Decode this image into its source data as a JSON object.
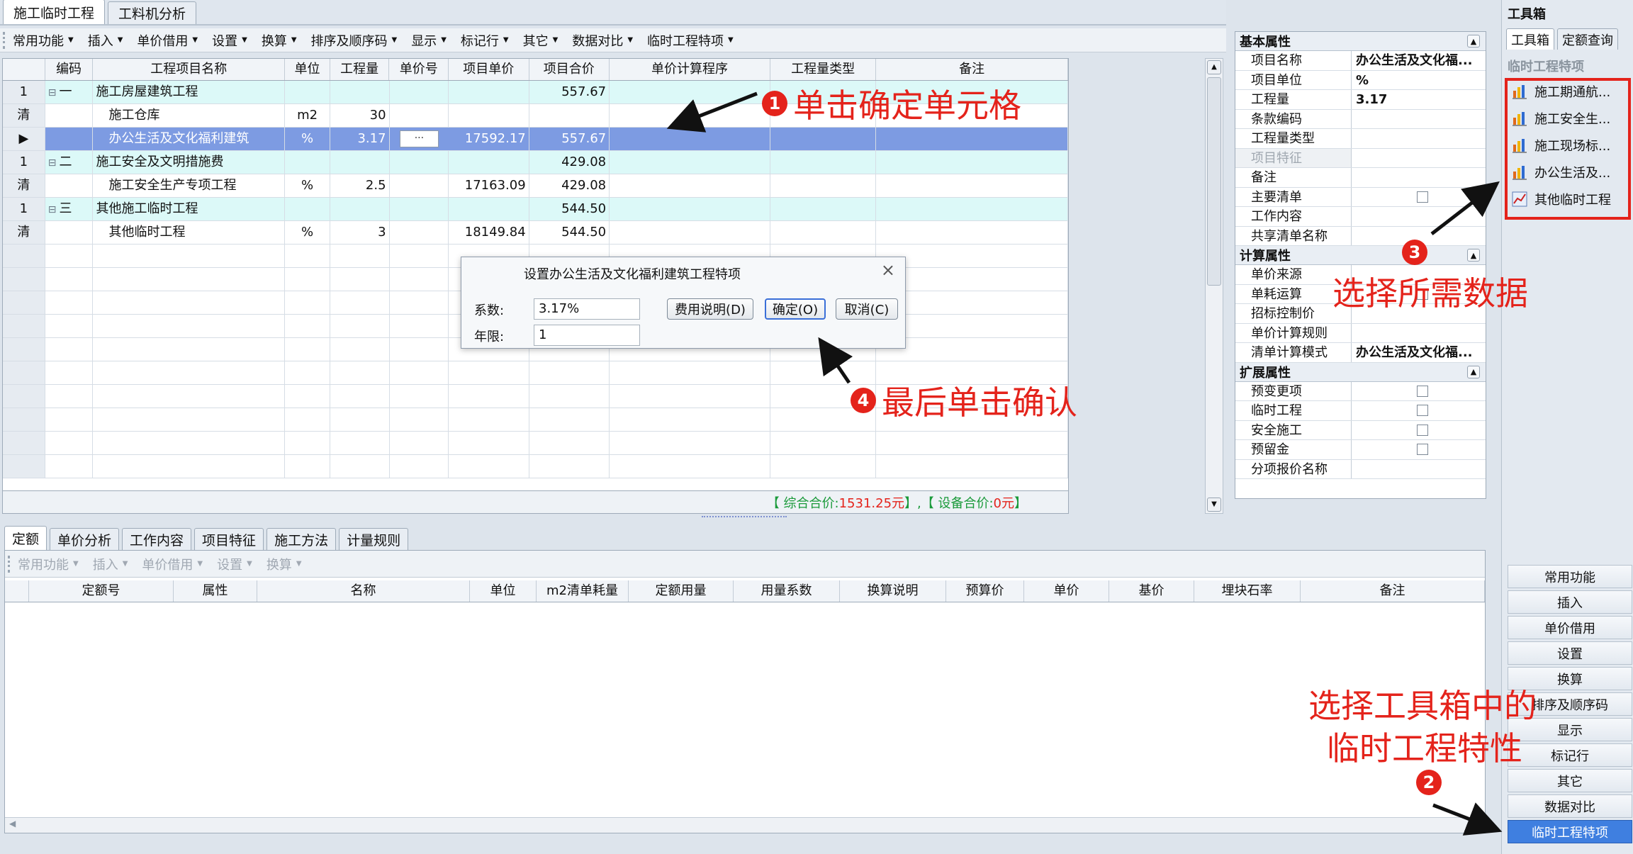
{
  "top_tabs": [
    "施工临时工程",
    "工料机分析"
  ],
  "toolbar": [
    "常用功能",
    "插入",
    "单价借用",
    "设置",
    "换算",
    "排序及顺序码",
    "显示",
    "标记行",
    "其它",
    "数据对比",
    "临时工程特项"
  ],
  "grid": {
    "columns": [
      "编码",
      "工程项目名称",
      "单位",
      "工程量",
      "单价号",
      "项目单价",
      "项目合价",
      "单价计算程序",
      "工程量类型",
      "备注"
    ],
    "rows": [
      {
        "rowhead": "1",
        "tree": "⊟",
        "code": "一",
        "name": "施工房屋建筑工程",
        "unit": "",
        "qty": "",
        "price_no": "",
        "unit_price": "",
        "total": "557.67",
        "kind": "group"
      },
      {
        "rowhead": "清",
        "tree": "",
        "code": "",
        "name": "施工仓库",
        "unit": "m2",
        "qty": "30",
        "price_no": "",
        "unit_price": "",
        "total": "",
        "kind": "item"
      },
      {
        "rowhead": "▶",
        "tree": "",
        "code": "",
        "name": "办公生活及文化福利建筑",
        "unit": "%",
        "qty": "3.17",
        "price_no": "···",
        "unit_price": "17592.17",
        "total": "557.67",
        "kind": "selected"
      },
      {
        "rowhead": "1",
        "tree": "⊟",
        "code": "二",
        "name": "施工安全及文明措施费",
        "unit": "",
        "qty": "",
        "price_no": "",
        "unit_price": "",
        "total": "429.08",
        "kind": "group"
      },
      {
        "rowhead": "清",
        "tree": "",
        "code": "",
        "name": "施工安全生产专项工程",
        "unit": "%",
        "qty": "2.5",
        "price_no": "",
        "unit_price": "17163.09",
        "total": "429.08",
        "kind": "item"
      },
      {
        "rowhead": "1",
        "tree": "⊟",
        "code": "三",
        "name": "其他施工临时工程",
        "unit": "",
        "qty": "",
        "price_no": "",
        "unit_price": "",
        "total": "544.50",
        "kind": "group"
      },
      {
        "rowhead": "清",
        "tree": "",
        "code": "",
        "name": "其他临时工程",
        "unit": "%",
        "qty": "3",
        "price_no": "",
        "unit_price": "18149.84",
        "total": "544.50",
        "kind": "item"
      }
    ],
    "footer_prefix": "【 综合合价: ",
    "footer_total": "1531.25元",
    "footer_mid": " 】,【 设备合价: ",
    "footer_device": "0元",
    "footer_suffix": " 】"
  },
  "dialog": {
    "title": "设置办公生活及文化福利建筑工程特项",
    "coef_label": "系数:",
    "coef_value": "3.17%",
    "years_label": "年限:",
    "years_value": "1",
    "btn_desc": "费用说明(D)",
    "btn_ok": "确定(O)",
    "btn_cancel": "取消(C)"
  },
  "properties": {
    "basic_title": "基本属性",
    "basic": [
      {
        "k": "项目名称",
        "v": "办公生活及文化福...",
        "type": "text"
      },
      {
        "k": "项目单位",
        "v": "%",
        "type": "text"
      },
      {
        "k": "工程量",
        "v": "3.17",
        "type": "text"
      },
      {
        "k": "条款编码",
        "v": "",
        "type": "text"
      },
      {
        "k": "工程量类型",
        "v": "",
        "type": "text"
      },
      {
        "k": "项目特征",
        "v": "",
        "type": "disabled"
      },
      {
        "k": "备注",
        "v": "",
        "type": "text"
      },
      {
        "k": "主要清单",
        "v": "",
        "type": "check"
      },
      {
        "k": "工作内容",
        "v": "",
        "type": "text"
      },
      {
        "k": "共享清单名称",
        "v": "",
        "type": "text"
      }
    ],
    "calc_title": "计算属性",
    "calc": [
      {
        "k": "单价来源",
        "v": "",
        "type": "text"
      },
      {
        "k": "单耗运算",
        "v": "",
        "type": "check"
      },
      {
        "k": "招标控制价",
        "v": "",
        "type": "text"
      },
      {
        "k": "单价计算规则",
        "v": "",
        "type": "text"
      },
      {
        "k": "清单计算模式",
        "v": "办公生活及文化福...",
        "type": "text"
      }
    ],
    "ext_title": "扩展属性",
    "ext": [
      {
        "k": "预变更项",
        "v": "",
        "type": "check"
      },
      {
        "k": "临时工程",
        "v": "",
        "type": "check"
      },
      {
        "k": "安全施工",
        "v": "",
        "type": "check"
      },
      {
        "k": "预留金",
        "v": "",
        "type": "check"
      },
      {
        "k": "分项报价名称",
        "v": "",
        "type": "text"
      }
    ]
  },
  "bottom_tabs": [
    "定额",
    "单价分析",
    "工作内容",
    "项目特征",
    "施工方法",
    "计量规则"
  ],
  "bottom_toolbar": [
    "常用功能",
    "插入",
    "单价借用",
    "设置",
    "换算"
  ],
  "bottom_columns": [
    "定额号",
    "属性",
    "名称",
    "单位",
    "m2清单耗量",
    "定额用量",
    "用量系数",
    "换算说明",
    "预算价",
    "单价",
    "基价",
    "埋块石率",
    "备注"
  ],
  "toolbox": {
    "title": "工具箱",
    "tabs": [
      "工具箱",
      "定额查询"
    ],
    "section": "临时工程特项",
    "items": [
      "施工期通航...",
      "施工安全生...",
      "施工现场标...",
      "办公生活及...",
      "其他临时工程"
    ],
    "buttons": [
      "常用功能",
      "插入",
      "单价借用",
      "设置",
      "换算",
      "排序及顺序码",
      "显示",
      "标记行",
      "其它",
      "数据对比",
      "临时工程特项"
    ]
  },
  "annotations": {
    "a1_num": "1",
    "a1": "单击确定单元格",
    "a2_num": "2",
    "a2_line1": "选择工具箱中的",
    "a2_line2": "临时工程特性",
    "a3_num": "3",
    "a3": "选择所需数据",
    "a4_num": "4",
    "a4": "最后单击确认"
  },
  "colors": {
    "accent_red": "#e4231b",
    "selected_row": "#7d9be2",
    "group_row": "#dcf9f8",
    "footer_green": "#1a9a3a"
  }
}
